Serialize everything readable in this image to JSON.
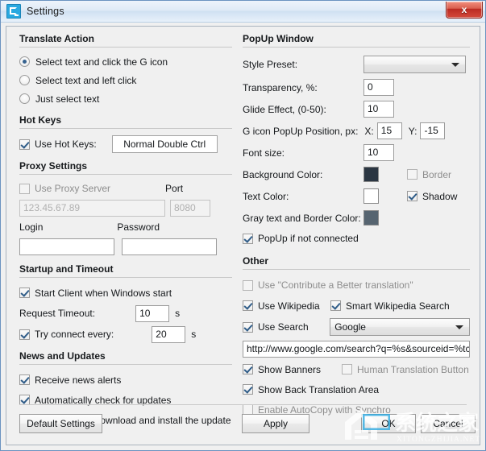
{
  "window": {
    "title": "Settings",
    "icon": "app-logo-icon",
    "close_label": "x"
  },
  "left": {
    "translate_action": {
      "title": "Translate Action",
      "options": [
        {
          "label": "Select text and click the G icon",
          "selected": true
        },
        {
          "label": "Select text and left click",
          "selected": false
        },
        {
          "label": "Just select text",
          "selected": false
        }
      ]
    },
    "hot_keys": {
      "title": "Hot Keys",
      "use_label": "Use Hot Keys:",
      "use_checked": true,
      "combo_label": "Normal Double Ctrl"
    },
    "proxy": {
      "title": "Proxy Settings",
      "use_label": "Use Proxy Server",
      "use_checked": false,
      "port_label": "Port",
      "server_value": "123.45.67.89",
      "port_value": "8080",
      "login_label": "Login",
      "login_value": "",
      "password_label": "Password",
      "password_value": ""
    },
    "startup": {
      "title": "Startup and Timeout",
      "start_client_label": "Start Client when Windows start",
      "start_client_checked": true,
      "request_timeout_label": "Request Timeout:",
      "request_timeout_value": "10",
      "request_timeout_unit": "s",
      "try_connect_label": "Try connect every:",
      "try_connect_checked": true,
      "try_connect_value": "20",
      "try_connect_unit": "s"
    },
    "news": {
      "title": "News and Updates",
      "items": [
        {
          "label": "Receive news alerts",
          "checked": true
        },
        {
          "label": "Automatically check for updates",
          "checked": true
        },
        {
          "label": "Automatically download and install the update",
          "checked": true
        }
      ]
    }
  },
  "right": {
    "popup": {
      "title": "PopUp Window",
      "style_preset_label": "Style Preset:",
      "style_preset_value": "",
      "transparency_label": "Transparency, %:",
      "transparency_value": "0",
      "glide_label": "Glide Effect, (0-50):",
      "glide_value": "10",
      "position_label": "G icon PopUp Position, px:",
      "position_x_label": "X:",
      "position_x_value": "15",
      "position_y_label": "Y:",
      "position_y_value": "-15",
      "font_size_label": "Font size:",
      "font_size_value": "10",
      "background_color_label": "Background Color:",
      "background_color_value": "#2b3642",
      "text_color_label": "Text Color:",
      "text_color_value": "#ffffff",
      "gray_color_label": "Gray text and Border Color:",
      "gray_color_value": "#566470",
      "border_label": "Border",
      "border_checked": false,
      "shadow_label": "Shadow",
      "shadow_checked": true,
      "popup_not_connected_label": "PopUp if not connected",
      "popup_not_connected_checked": true
    },
    "other": {
      "title": "Other",
      "contribute_label": "Use \"Contribute a Better translation\"",
      "contribute_checked": false,
      "wikipedia_label": "Use Wikipedia",
      "wikipedia_checked": true,
      "smart_wikipedia_label": "Smart Wikipedia Search",
      "smart_wikipedia_checked": true,
      "use_search_label": "Use Search",
      "use_search_checked": true,
      "engine_value": "Google",
      "search_url_value": "http://www.google.com/search?q=%s&sourceid=%tc&ie",
      "show_banners_label": "Show Banners",
      "show_banners_checked": true,
      "human_translation_label": "Human Translation Button",
      "human_translation_checked": false,
      "back_translation_label": "Show Back Translation Area",
      "back_translation_checked": true,
      "autocopy_label": "Enable AutoCopy with Synchro",
      "autocopy_checked": false
    }
  },
  "footer": {
    "default_settings_label": "Default Settings",
    "apply_label": "Apply",
    "ok_label": "OK",
    "cancel_label": "Cancel"
  },
  "watermark": {
    "text_cn": "系统之家",
    "text_en": "XITONGZHIJIA.NET"
  }
}
